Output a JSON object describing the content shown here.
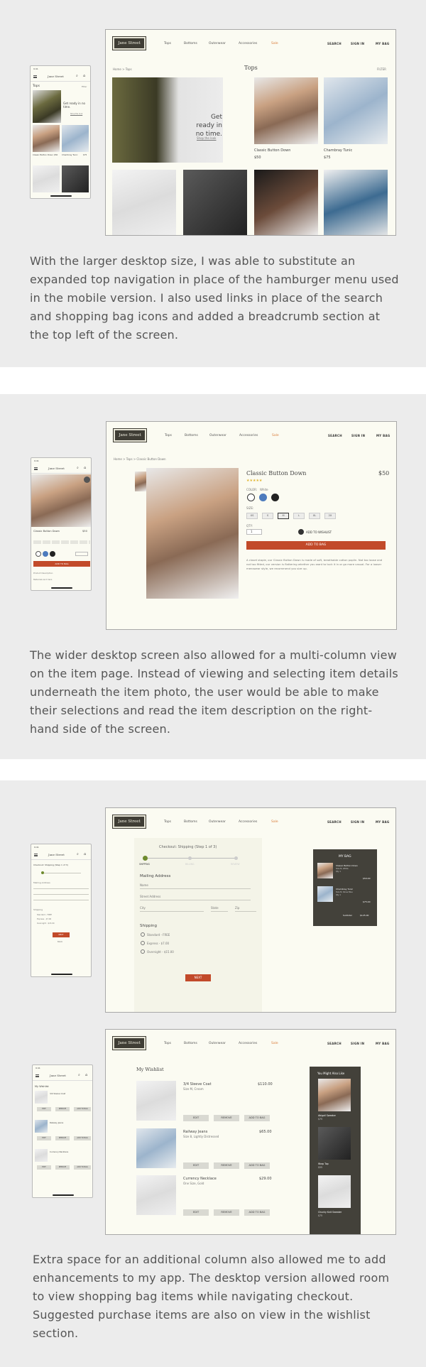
{
  "nav": {
    "logo": "Jane Street",
    "links": [
      "Tops",
      "Bottoms",
      "Outerwear",
      "Accessories",
      "Sale"
    ],
    "right": [
      "SEARCH",
      "SIGN IN",
      "MY BAG"
    ]
  },
  "section1": {
    "paragraph": "With the larger desktop size, I was able to substitute an expanded top navigation in place of the hamburger menu used in the mobile version. I also used links in place of the search and shopping bag icons and added a breadcrumb section at the top left of the screen.",
    "breadcrumb": "Home > Tops",
    "page_title": "Tops",
    "filter": "FILTER",
    "hero_text": "Get ready in no time.",
    "hero_link": "Shop the look",
    "products": [
      {
        "name": "Classic Button Down",
        "price": "$50"
      },
      {
        "name": "Chambray Tunic",
        "price": "$75"
      }
    ],
    "mobile": {
      "logo": "Jane Street",
      "title": "Tops",
      "filter": "Filter",
      "hero": "Get ready in no time.",
      "hero_link": "Shop the look",
      "p1": "Classic Button Down",
      "p1_price": "$50",
      "p2": "Chambray Tunic",
      "p2_price": "$75"
    }
  },
  "section2": {
    "paragraph": "The wider desktop screen also allowed for a multi-column view on the item page. Instead of viewing and selecting item details underneath the item photo, the user would be able to make their selections and read the item description on the right-hand side of the screen.",
    "breadcrumb": "Home > Tops > Classic Button Down",
    "product_name": "Classic Button Down",
    "price": "$50",
    "stars": "★★★★★",
    "color_label": "COLOR:",
    "color_value": "White",
    "size_label": "SIZE:",
    "sizes": [
      "XS",
      "S",
      "M",
      "L",
      "XL",
      "2X"
    ],
    "qty_label": "QTY:",
    "qty_value": "1",
    "wishlist": "ADD TO WISHLIST",
    "add_to_bag": "ADD TO BAG",
    "description": "A closet staple, our Classic Button Down is made of soft, breathable cotton poplin. Not too loose and not too fitted, our version is flattering whether you want to tuck it in or go more casual. For a looser menswear style, we recommend you size up.",
    "mobile": {
      "logo": "Jane Street",
      "name": "Classic Button Down",
      "price": "$50",
      "add": "ADD TO BAG",
      "desc1": "Product Description",
      "desc2": "Materials and Care"
    }
  },
  "section3": {
    "checkout_title": "Checkout: Shipping (Step 1 of 3)",
    "steps": [
      "SHIPPING",
      "BILLING",
      "REVIEW"
    ],
    "mailing": "Mailing Address",
    "name_ph": "Name",
    "street_ph": "Street Address",
    "city_ph": "City",
    "state_ph": "State",
    "zip_ph": "Zip",
    "shipping": "Shipping",
    "options": [
      "Standard - FREE",
      "Express - $7.00",
      "Overnight - $15.00"
    ],
    "next": "NEXT",
    "bag_title": "MY BAG",
    "bag_items": [
      {
        "name": "Classic Button Down",
        "meta1": "Size M, White",
        "meta2": "Qty 1",
        "price": "$50.00"
      },
      {
        "name": "Chambray Tunic",
        "meta1": "Size M, Rinse Blue",
        "meta2": "Qty 1",
        "price": "$75.00"
      }
    ],
    "subtotal_label": "Subtotal",
    "subtotal": "$125.00",
    "mobile": {
      "logo": "Jane Street",
      "title": "Checkout: Shipping (Step 1 of 3)",
      "mailing": "Mailing Address",
      "shipping": "Shipping",
      "options": [
        "Standard - FREE",
        "Express - $7.00",
        "Overnight - $15.00"
      ],
      "next": "NEXT",
      "back": "BACK"
    }
  },
  "section4": {
    "title": "My Wishlist",
    "items": [
      {
        "name": "3/4 Sleeve Coat",
        "meta": "Size M, Cream",
        "price": "$110.00"
      },
      {
        "name": "Railway Jeans",
        "meta": "Size 8, Lightly Distressed",
        "price": "$65.00"
      },
      {
        "name": "Currency Necklace",
        "meta": "One Size, Gold",
        "price": "$29.00"
      }
    ],
    "actions": [
      "EDIT",
      "REMOVE",
      "ADD TO BAG"
    ],
    "suggest_title": "You Might Also Like",
    "suggest": [
      {
        "name": "Abigail Sweater",
        "price": "$75"
      },
      {
        "name": "Wrap Top",
        "price": "$55"
      },
      {
        "name": "Chunky Knit Sweater",
        "price": "$75"
      }
    ],
    "mobile": {
      "logo": "Jane Street",
      "title": "My Wishlist",
      "items": [
        "3/4 Sleeve Coat",
        "Railway Jeans",
        "Currency Necklace"
      ],
      "actions": [
        "EDIT",
        "REMOVE",
        "ADD TO BAG"
      ]
    }
  },
  "section5": {
    "paragraph": "Extra space for an additional column also allowed me to add enhancements to my app. The desktop version allowed room to view shopping bag items while navigating checkout. Suggested purchase items are also on view in the wishlist section."
  },
  "colors": {
    "page_bg": "#ececec",
    "screen_bg": "#fbfbf2",
    "accent": "#c24a2a",
    "sale": "#d97c3a",
    "dark_panel": "#43413a"
  }
}
